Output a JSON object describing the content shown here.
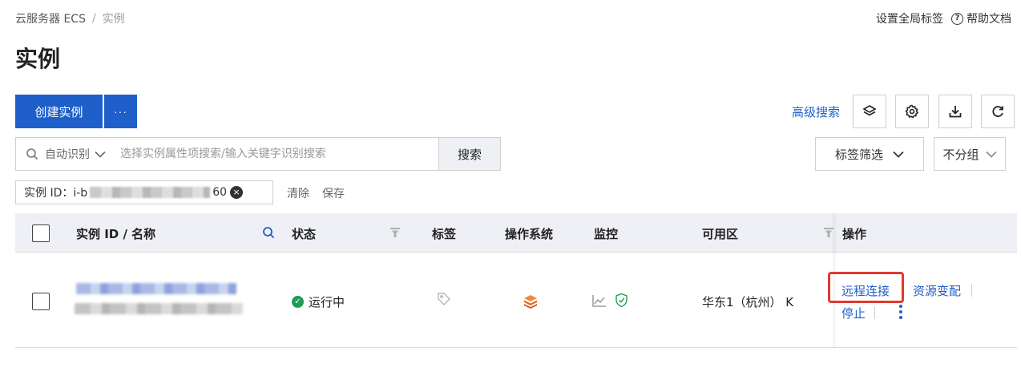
{
  "breadcrumb": {
    "root": "云服务器 ECS",
    "separator": "/",
    "current": "实例"
  },
  "top_links": {
    "global_tags": "设置全局标签",
    "help_icon": "?",
    "help": "帮助文档"
  },
  "page_title": "实例",
  "toolbar": {
    "create_label": "创建实例",
    "more_label": "···",
    "advanced_search": "高级搜索",
    "icons": [
      "layers-icon",
      "gear-icon",
      "download-icon",
      "refresh-icon"
    ]
  },
  "search": {
    "mode": "自动识别",
    "placeholder": "选择实例属性项搜索/输入关键字识别搜索",
    "button": "搜索",
    "tag_filter": "标签筛选",
    "grouping": "不分组"
  },
  "filter_chip": {
    "label": "实例 ID：i-b",
    "suffix": "60",
    "close": "×",
    "clear": "清除",
    "save": "保存"
  },
  "table": {
    "columns": {
      "id_name": "实例 ID / 名称",
      "status": "状态",
      "tags": "标签",
      "os": "操作系统",
      "monitor": "监控",
      "zone": "可用区",
      "actions": "操作"
    },
    "rows": [
      {
        "status_icon": "✓",
        "status": "运行中",
        "zone": "华东1（杭州） K",
        "actions": {
          "remote": "远程连接",
          "resize": "资源变配",
          "stop": "停止"
        }
      }
    ]
  },
  "colors": {
    "primary": "#1f5fc9",
    "running": "#1f9d55",
    "os_icon": "#e8742a",
    "highlight": "#e03a2f",
    "header_bg": "#eef0f5"
  }
}
